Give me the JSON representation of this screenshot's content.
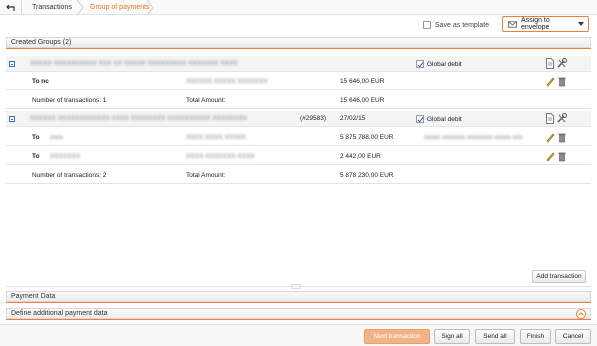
{
  "breadcrumb": {
    "items": [
      "Transactions",
      "Group of payments"
    ]
  },
  "toolbar": {
    "save_as_template": "Save as template",
    "assign_label": "Assign to envelope"
  },
  "groups_section": {
    "title": "Created Groups (2)"
  },
  "groups": [
    {
      "name_blurred": "XXXXX XXXXXXXXXX XXX XX XXXXX XXXXXXXXX XXXXXXX XXXX",
      "date": "",
      "global_debit": "Global debit",
      "rows": [
        {
          "to_label": "To nc",
          "account_blurred": "XXXXXX XXXXX XXXXXXX",
          "amount": "15 646,00 EUR",
          "note_blurred": ""
        }
      ],
      "count_label": "Number of transactions: 1",
      "total_label": "Total Amount:",
      "total_value": "15 646,00 EUR"
    },
    {
      "name_blurred": "XXXXXX XXXXXXXXXXXX XXXX XXXXXXXX XXXXXXXXXX XXXXXXXX",
      "ref": "(#29583)",
      "date": "27/02/15",
      "global_debit": "Global debit",
      "rows": [
        {
          "to_label": "To",
          "to_blurred": "xxxx",
          "account_blurred": "XXXX XXXX XXXXX",
          "amount": "5 875 788,00 EUR",
          "note_blurred": "xxxxx xxxxxxx xxxxxxxx xxxxx xxx"
        },
        {
          "to_label": "To",
          "to_blurred": "XXXXXXX",
          "account_blurred": "XXXX XXXXXXX XXXX",
          "amount": "2 442,00 EUR",
          "note_blurred": ""
        }
      ],
      "count_label": "Number of transactions: 2",
      "total_label": "Total Amount:",
      "total_value": "5 878 230,00 EUR"
    }
  ],
  "add_transaction": "Add transaction",
  "payment_section": {
    "title": "Payment Data"
  },
  "additional_section": {
    "title": "Define additional payment data"
  },
  "footer": {
    "next": "Next transaction",
    "sign_all": "Sign all",
    "send_all": "Send all",
    "finish": "Finish",
    "cancel": "Cancel"
  },
  "colors": {
    "accent": "#e8823a",
    "link": "#3a6cc0"
  }
}
